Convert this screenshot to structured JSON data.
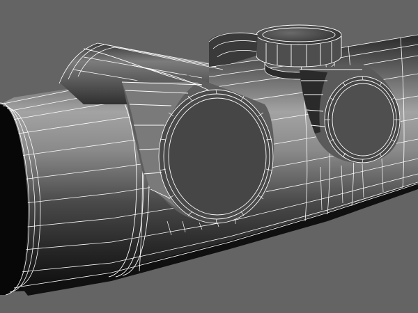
{
  "viewport": {
    "background": "#646464",
    "wire_color": "#ffffff",
    "shade_dark": "#0f0f0f",
    "shade_mid": "#3c3c3c",
    "shade_light": "#9a9a9a",
    "subject": "wireframe-scope-model"
  }
}
